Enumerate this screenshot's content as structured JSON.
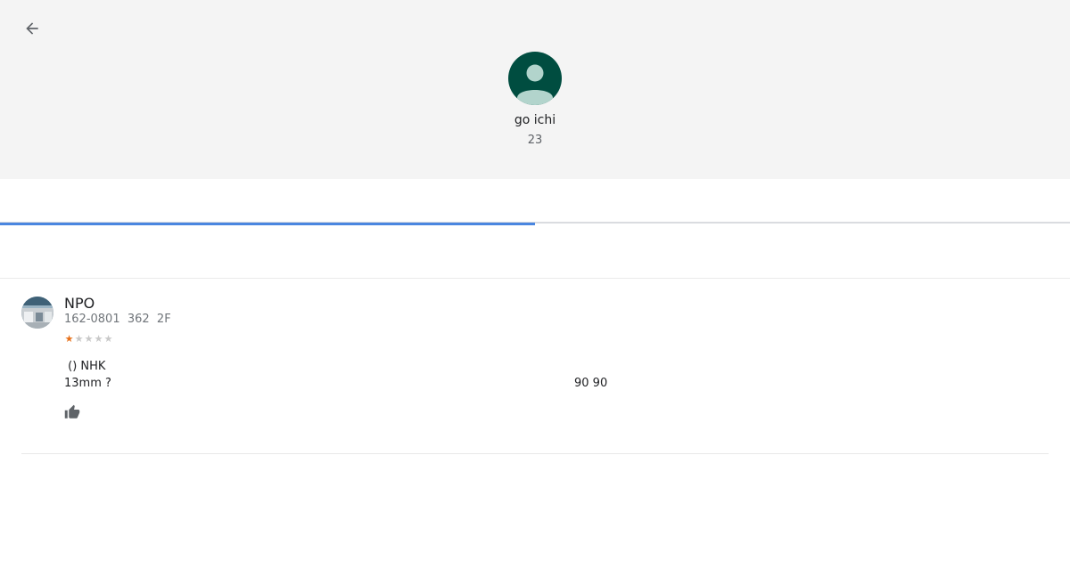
{
  "header": {
    "back_icon": "arrow-left-icon",
    "profile": {
      "name": "go ichi",
      "count": "23",
      "avatar_color": "#004d40"
    }
  },
  "tabs": {
    "active_index": 0,
    "accent_color": "#4a86e0"
  },
  "review": {
    "place_name": "NPO",
    "address": "162-0801  362  2F",
    "rating": 1,
    "rating_max": 5,
    "star_color": "#e7711b",
    "text_line1": " () NHK",
    "text_line2": "13mm ?",
    "text_line2_right": "90 90",
    "like_icon": "thumbs-up-icon"
  }
}
